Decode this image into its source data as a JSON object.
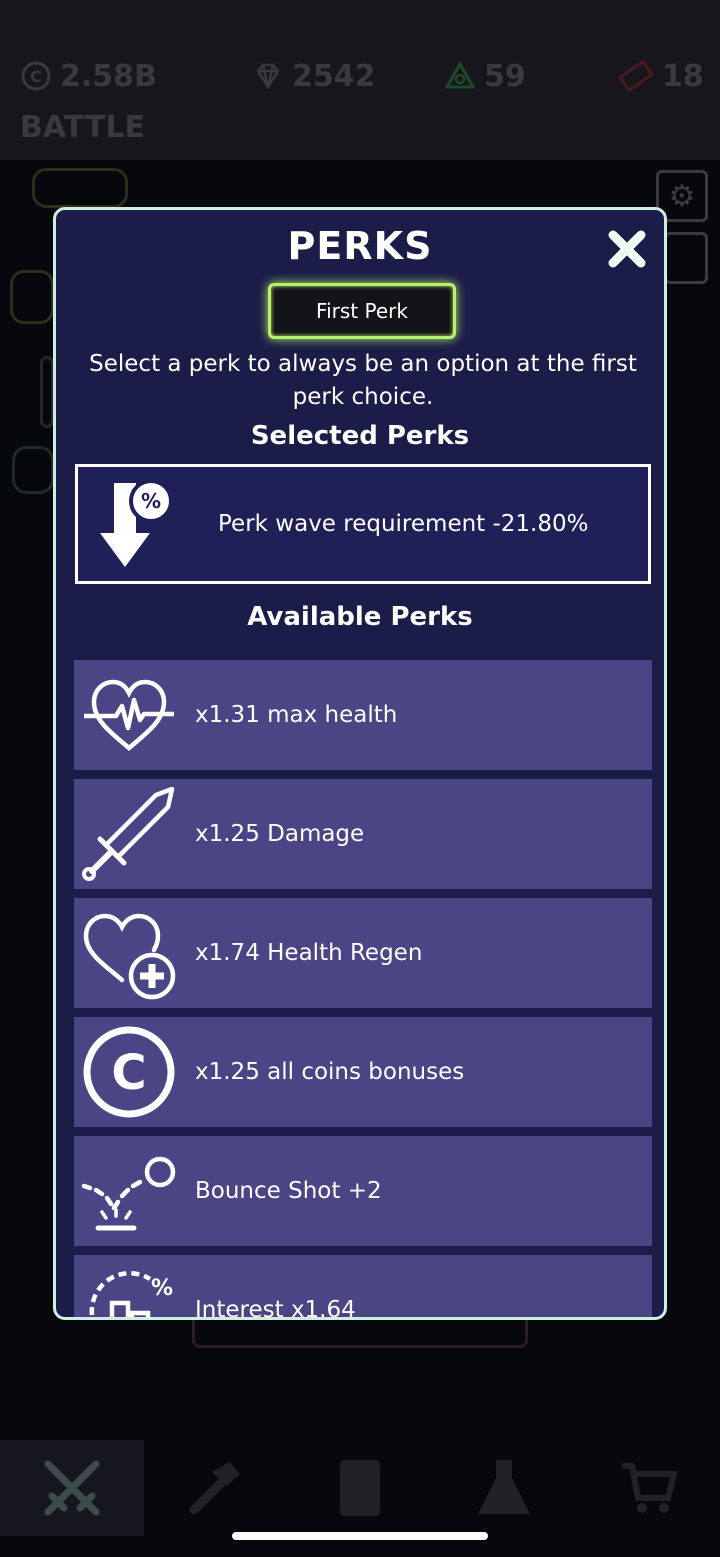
{
  "top_bar": {
    "coins": "2.58B",
    "gems": "2542",
    "medals": "59",
    "tickets": "18",
    "screen_label": "BATTLE"
  },
  "modal": {
    "title": "PERKS",
    "perk_type_button": "First Perk",
    "description": "Select a perk to always be an option at the first perk choice.",
    "selected_heading": "Selected Perks",
    "selected_perk": {
      "icon": "wave-percent-down-icon",
      "label": "Perk wave requirement -21.80%"
    },
    "available_heading": "Available Perks",
    "available_perks": [
      {
        "icon": "heartbeat-icon",
        "label": "x1.31 max health"
      },
      {
        "icon": "sword-icon",
        "label": "x1.25 Damage"
      },
      {
        "icon": "heart-plus-icon",
        "label": "x1.74 Health Regen"
      },
      {
        "icon": "coin-icon",
        "label": "x1.25 all coins bonuses"
      },
      {
        "icon": "bounce-shot-icon",
        "label": "Bounce Shot +2"
      },
      {
        "icon": "interest-chart-icon",
        "label": "Interest x1.64"
      }
    ]
  },
  "bottom_nav": {
    "tabs": [
      {
        "icon": "crossed-swords-icon",
        "active": true
      },
      {
        "icon": "hammer-icon",
        "active": false
      },
      {
        "icon": "card-icon",
        "active": false
      },
      {
        "icon": "flask-icon",
        "active": false
      },
      {
        "icon": "cart-icon",
        "active": false
      }
    ]
  },
  "colors": {
    "modal_bg": "#1c1c48",
    "modal_border": "#cfeede",
    "row_bg": "#4a4585",
    "selected_bg": "#202058",
    "accent_green": "#b8f26a"
  }
}
